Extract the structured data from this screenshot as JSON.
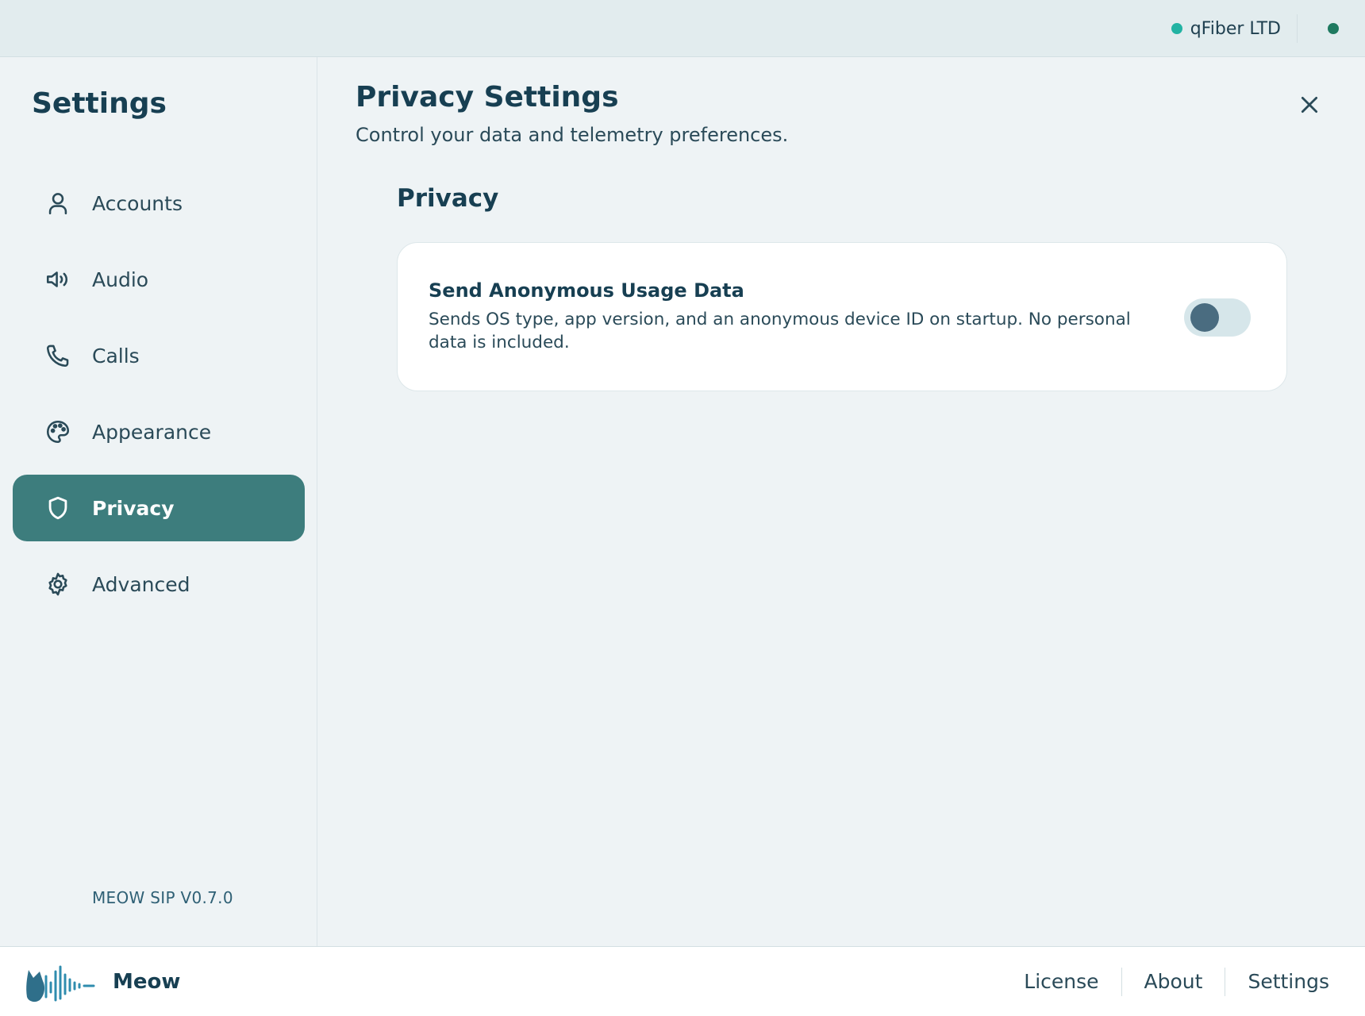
{
  "colors": {
    "accent": "#3d7d7d",
    "presence_dot": "#22b3a3",
    "connection_dot": "#1f7a60",
    "heading": "#173f52",
    "toggle_track_off": "#d6e6ea",
    "toggle_knob_off": "#4a6c80"
  },
  "topbar": {
    "account_name": "qFiber LTD",
    "account_status_icon": "status-dot-icon",
    "connection_icon": "connection-dot-icon"
  },
  "sidebar": {
    "title": "Settings",
    "items": [
      {
        "label": "Accounts",
        "icon": "user-icon",
        "active": false
      },
      {
        "label": "Audio",
        "icon": "speaker-icon",
        "active": false
      },
      {
        "label": "Calls",
        "icon": "phone-icon",
        "active": false
      },
      {
        "label": "Appearance",
        "icon": "palette-icon",
        "active": false
      },
      {
        "label": "Privacy",
        "icon": "shield-icon",
        "active": true
      },
      {
        "label": "Advanced",
        "icon": "gear-icon",
        "active": false
      }
    ],
    "version": "MEOW SIP V0.7.0"
  },
  "main": {
    "title": "Privacy Settings",
    "subtitle": "Control your data and telemetry preferences.",
    "close_icon": "close-icon",
    "section": {
      "title": "Privacy",
      "settings": [
        {
          "label": "Send Anonymous Usage Data",
          "description": "Sends OS type, app version, and an anonymous device ID on startup. No personal data is included.",
          "enabled": false
        }
      ]
    }
  },
  "footer": {
    "brand_name": "Meow",
    "brand_logo": "meow-logo-icon",
    "links": [
      "License",
      "About",
      "Settings"
    ]
  }
}
